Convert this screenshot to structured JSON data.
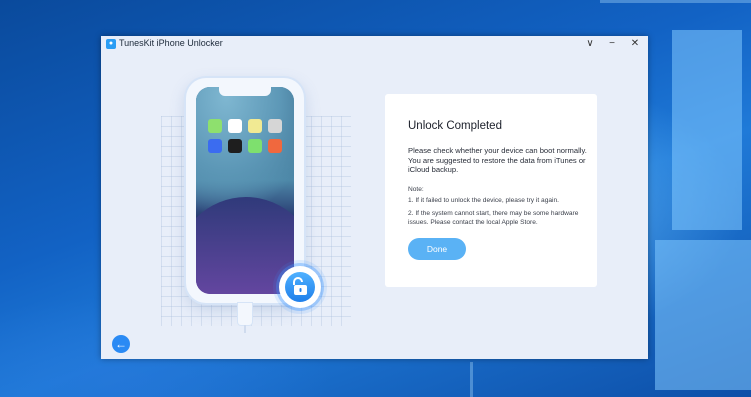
{
  "window": {
    "title": "TunesKit iPhone Unlocker",
    "controls": {
      "minimize": "−",
      "maximize": "∨",
      "close": "✕"
    }
  },
  "panel": {
    "title": "Unlock Completed",
    "description": "Please check whether your device can boot normally. You are suggested to restore the data from iTunes or iCloud backup.",
    "note_label": "Note:",
    "notes": [
      "1. If it failed to unlock the device, please try it again.",
      "2. If the system cannot start, there may be some hardware issues. Please contact the local Apple Store."
    ],
    "done_label": "Done"
  },
  "icons": {
    "app": "app-logo-icon",
    "back": "back-arrow-icon",
    "lock": "unlock-icon"
  },
  "colors": {
    "accent": "#2a8af4",
    "done_button": "#5ab2f5",
    "window_bg": "#e8eef9",
    "app_tiles": [
      "#8ee06e",
      "#ffffff",
      "#f1ea93",
      "#d6d6d6",
      "#3b6cf0",
      "#1e1e1e",
      "#7ee06e",
      "#f0683e"
    ]
  }
}
